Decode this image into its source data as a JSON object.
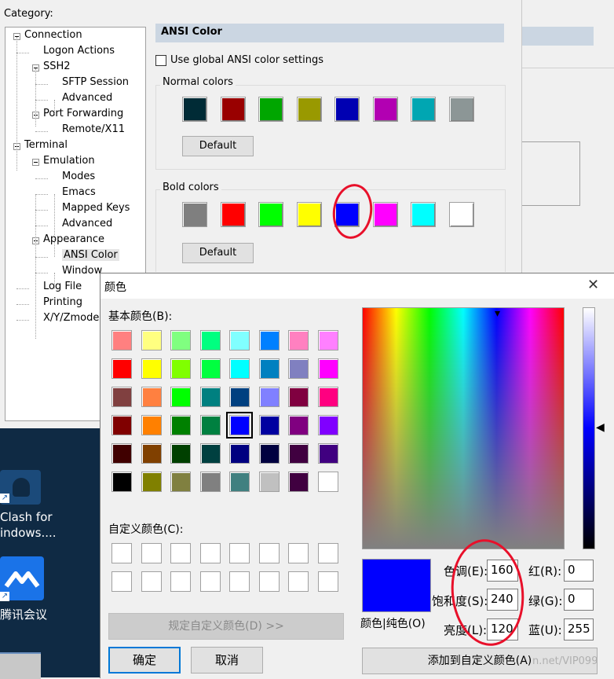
{
  "options": {
    "category_label": "Category:",
    "tree": [
      {
        "label": "Connection",
        "level": 0
      },
      {
        "label": "Logon Actions",
        "level": 1
      },
      {
        "label": "SSH2",
        "level": 1
      },
      {
        "label": "SFTP Session",
        "level": 2
      },
      {
        "label": "Advanced",
        "level": 2
      },
      {
        "label": "Port Forwarding",
        "level": 1
      },
      {
        "label": "Remote/X11",
        "level": 2
      },
      {
        "label": "Terminal",
        "level": 0
      },
      {
        "label": "Emulation",
        "level": 1
      },
      {
        "label": "Modes",
        "level": 2
      },
      {
        "label": "Emacs",
        "level": 2
      },
      {
        "label": "Mapped Keys",
        "level": 2
      },
      {
        "label": "Advanced",
        "level": 2
      },
      {
        "label": "Appearance",
        "level": 1
      },
      {
        "label": "ANSI Color",
        "level": 2,
        "selected": true
      },
      {
        "label": "Window",
        "level": 2
      },
      {
        "label": "Log File",
        "level": 1
      },
      {
        "label": "Printing",
        "level": 1
      },
      {
        "label": "X/Y/Zmodem",
        "level": 1
      }
    ],
    "section_title": "ANSI Color",
    "global_checkbox_label": "Use global ANSI color settings",
    "normal_colors_label": "Normal colors",
    "normal_colors": [
      "#002b36",
      "#990000",
      "#00a600",
      "#999900",
      "#0000b2",
      "#b200b2",
      "#00a6b2",
      "#8c9696"
    ],
    "bold_colors_label": "Bold colors",
    "bold_colors": [
      "#7f7f7f",
      "#ff0000",
      "#00ff00",
      "#ffff00",
      "#0000ff",
      "#ff00ff",
      "#00ffff",
      "#ffffff"
    ],
    "default_label": "Default"
  },
  "desktop": {
    "icons": [
      {
        "label1": "Clash for",
        "label2": "indows...."
      },
      {
        "label1": "腾讯会议",
        "label2": ""
      }
    ]
  },
  "dialog": {
    "title": "颜色",
    "close": "✕",
    "basic_label": "基本颜色(B):",
    "basic_colors": [
      "#ff8080",
      "#ffff80",
      "#80ff80",
      "#00ff80",
      "#80ffff",
      "#0080ff",
      "#ff80c0",
      "#ff80ff",
      "#ff0000",
      "#ffff00",
      "#80ff00",
      "#00ff40",
      "#00ffff",
      "#0080c0",
      "#8080c0",
      "#ff00ff",
      "#804040",
      "#ff8040",
      "#00ff00",
      "#008080",
      "#004080",
      "#8080ff",
      "#800040",
      "#ff0080",
      "#800000",
      "#ff8000",
      "#008000",
      "#008040",
      "#0000ff",
      "#0000a0",
      "#800080",
      "#8000ff",
      "#400000",
      "#804000",
      "#004000",
      "#004040",
      "#000080",
      "#000040",
      "#400040",
      "#400080",
      "#000000",
      "#808000",
      "#808040",
      "#808080",
      "#408080",
      "#c0c0c0",
      "#400040",
      "#ffffff"
    ],
    "selected_basic_index": 28,
    "custom_label": "自定义颜色(C):",
    "define_custom_label": "规定自定义颜色(D) >>",
    "ok_label": "确定",
    "cancel_label": "取消",
    "preview_color": "#0000ff",
    "solid_label": "颜色|纯色(O)",
    "hue_label": "色调(E):",
    "hue_value": "160",
    "sat_label": "饱和度(S):",
    "sat_value": "240",
    "lum_label": "亮度(L):",
    "lum_value": "120",
    "red_label": "红(R):",
    "red_value": "0",
    "green_label": "绿(G):",
    "green_value": "0",
    "blue_label": "蓝(U):",
    "blue_value": "255",
    "add_custom_label": "添加到自定义颜色(A)",
    "watermark": "n.net/VIP099"
  }
}
